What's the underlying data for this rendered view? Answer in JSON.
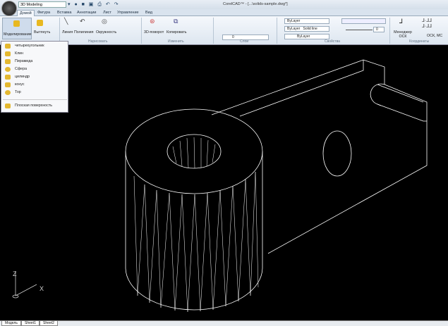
{
  "app": {
    "window_title": "CorelCAD™ - [...\\solids-sample.dwg*]",
    "workspace": "3D Modeling"
  },
  "tabs": [
    "Домой",
    "Фигура",
    "Вставка",
    "Аннотации",
    "Лист",
    "Управление",
    "Вид"
  ],
  "ribbon": {
    "buttons": {
      "modeling": "Моделирование",
      "extrude": "Вытянуть",
      "line": "Линия",
      "polyline": "Полилиния",
      "circle": "Окружность",
      "rotate3d": "3D-поворот",
      "copy": "Копировать",
      "ucs_manager": "Менеджер ОСК",
      "ucs_current": "ОСК, МС"
    },
    "groups": [
      "Нарисовать",
      "Изменить",
      "Слои",
      "Свойства",
      "Координаты"
    ],
    "layer": "0",
    "color": "ByLayer",
    "linetype_layer": "ByLayer",
    "linetype": "Solid line",
    "lineweight": "ByLayer",
    "transparency": "0"
  },
  "menu": {
    "items": [
      "четырехугольник",
      "Клин",
      "Пирамида",
      "Сфера",
      "цилиндр",
      "конус",
      "Тор",
      "Плоская поверхность"
    ]
  },
  "axes": {
    "z": "Z",
    "x": "X"
  },
  "sheets": [
    "Модель",
    "Sheet1",
    "Sheet2"
  ],
  "colors": {
    "canvas": "#000000",
    "wire": "#ffffff"
  }
}
